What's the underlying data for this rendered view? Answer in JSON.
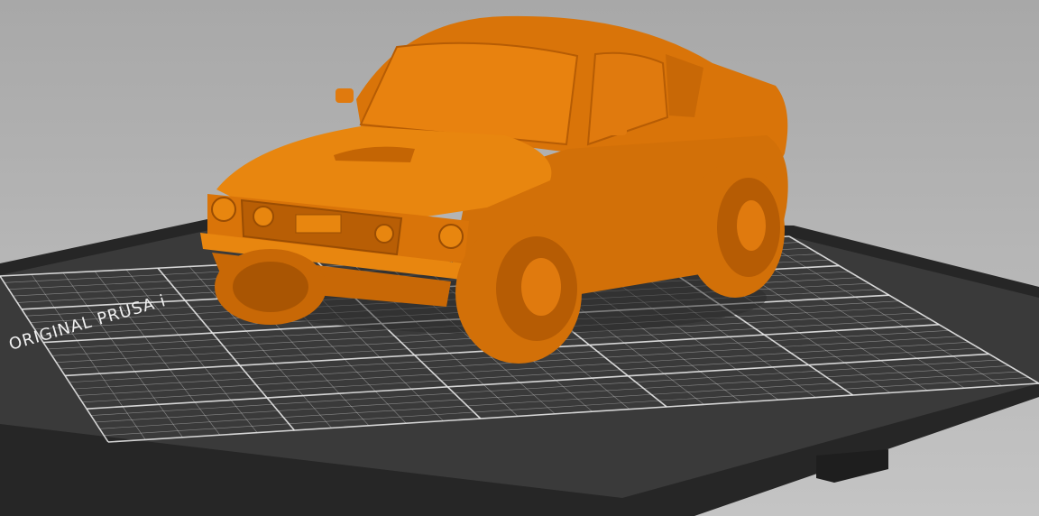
{
  "viewport": {
    "bed_logo_text": "ORIGINAL PRUSA i",
    "colors": {
      "background_top": "#a8a8a8",
      "background_bottom": "#c4c4c4",
      "bed": "#3a3a3a",
      "bed_frame": "#262626",
      "grid_line": "#e8e8e8",
      "model": "#e07a0e",
      "model_shadow": "#b85e05",
      "model_highlight": "#f09030"
    }
  }
}
